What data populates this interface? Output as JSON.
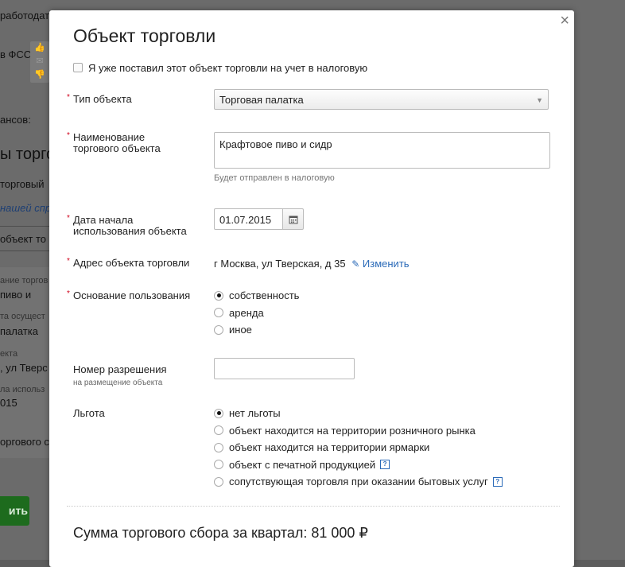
{
  "background": {
    "fragments": [
      "работодат",
      "в ФСС",
      "ансов:",
      "ы торго",
      "торговый",
      "нашей спр",
      " объект то",
      "ание торгов",
      "пиво и",
      "та осущест",
      " палатка",
      "екта",
      ", ул Тверс",
      "ла использ",
      "015",
      "оргового с",
      "ить"
    ]
  },
  "modal": {
    "title": "Объект торговли",
    "close_label": "×",
    "registered_checkbox": {
      "label": "Я уже поставил этот объект торговли на учет в налоговую",
      "checked": false
    },
    "object_type": {
      "label": "Тип объекта",
      "value": "Торговая палатка"
    },
    "object_name": {
      "label_line1": "Наименование",
      "label_line2": "торгового объекта",
      "value": "Крафтовое пиво и сидр",
      "hint": "Будет отправлен в налоговую"
    },
    "start_date": {
      "label_line1": "Дата начала",
      "label_line2": "использования объекта",
      "value": "01.07.2015"
    },
    "address": {
      "label": "Адрес объекта торговли",
      "value": "г Москва, ул Тверская, д 35",
      "edit_label": "Изменить"
    },
    "usage_basis": {
      "label": "Основание пользования",
      "options": [
        "собственность",
        "аренда",
        "иное"
      ],
      "selected": 0
    },
    "permit": {
      "label": "Номер разрешения",
      "sublabel": "на размещение объекта",
      "value": ""
    },
    "benefit": {
      "label": "Льгота",
      "options": [
        "нет льготы",
        "объект находится на территории розничного рынка",
        "объект находится на территории ярмарки",
        "объект с печатной продукцией",
        "сопутствующая торговля при оказании бытовых услуг"
      ],
      "help_mark": "?",
      "selected": 0
    },
    "total": "Сумма торгового сбора за квартал: 81 000 ₽"
  }
}
